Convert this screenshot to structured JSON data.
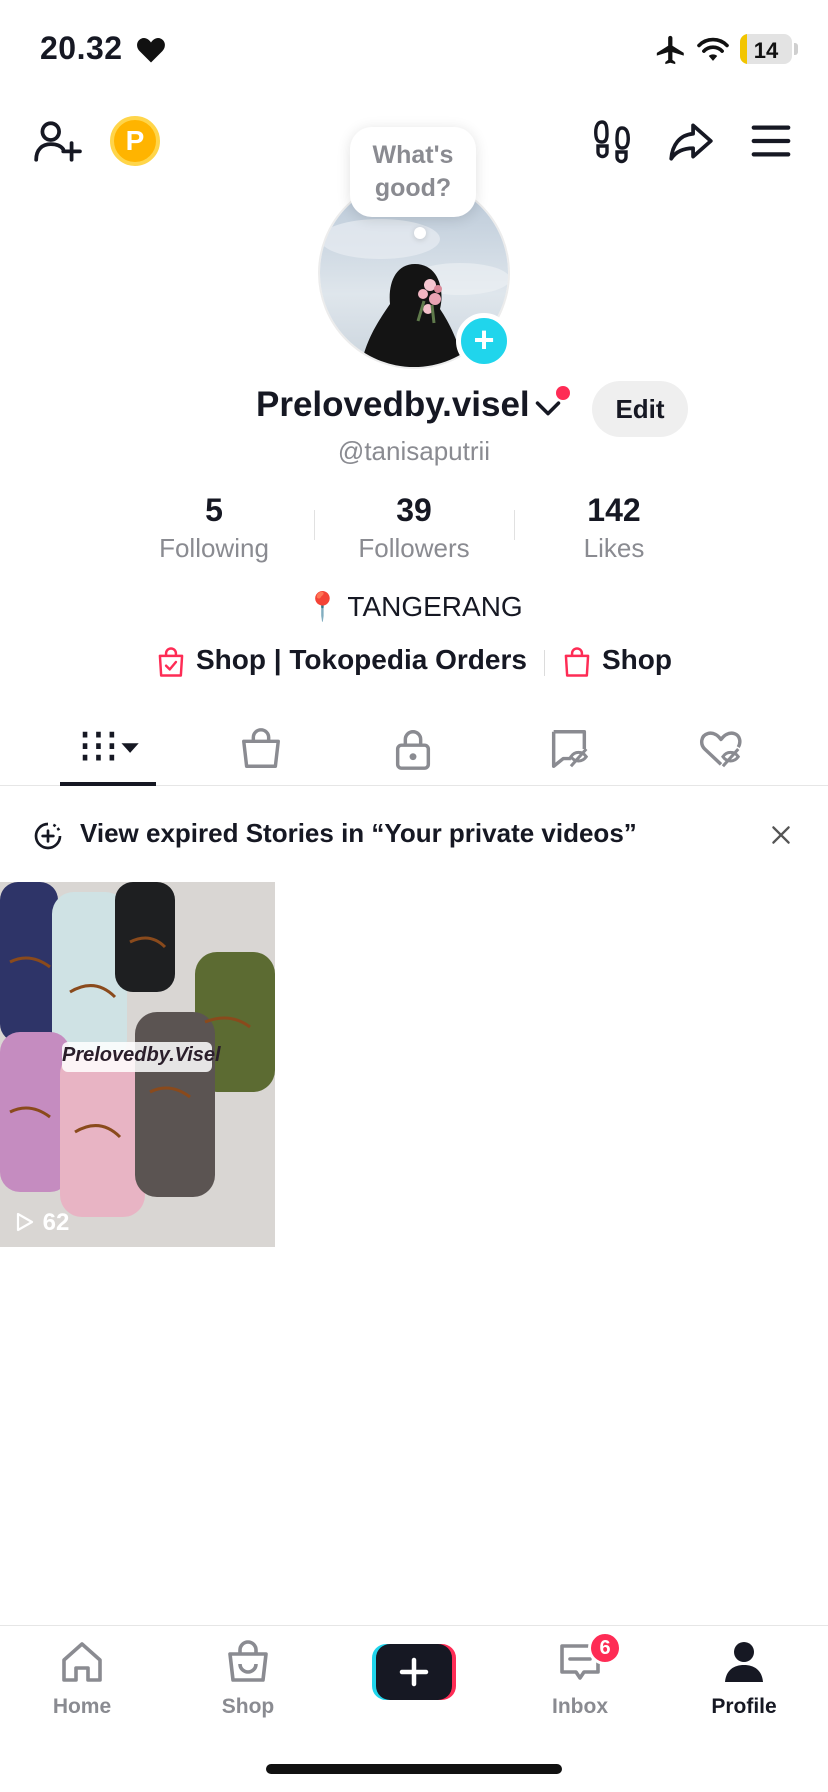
{
  "status_bar": {
    "time": "20.32",
    "battery_level": "14",
    "battery_fraction": 0.14,
    "icons": [
      "heart-icon",
      "airplane-icon",
      "wifi-icon",
      "battery-icon"
    ]
  },
  "header": {
    "icons": [
      "add-friend-icon",
      "coin-icon",
      "footprints-icon",
      "share-icon",
      "menu-icon"
    ],
    "coin_letter": "P"
  },
  "profile": {
    "note_bubble": "What's good?",
    "name": "Prelovedby.visel",
    "edit_label": "Edit",
    "handle": "@tanisaputrii",
    "location": "📍 TANGERANG"
  },
  "stats": [
    {
      "value": "5",
      "label": "Following"
    },
    {
      "value": "39",
      "label": "Followers"
    },
    {
      "value": "142",
      "label": "Likes"
    }
  ],
  "shop_links": [
    {
      "label": "Shop | Tokopedia Orders"
    },
    {
      "label": "Shop"
    }
  ],
  "tabs": [
    "videos-grid",
    "shop-bag",
    "private-lock",
    "reposts",
    "liked"
  ],
  "banner": {
    "text": "View expired Stories in “Your private videos”"
  },
  "videos": [
    {
      "views": "62",
      "overlay_text": "Prelovedby.Visel"
    }
  ],
  "bottom_nav": {
    "items": [
      {
        "label": "Home"
      },
      {
        "label": "Shop"
      },
      {
        "label": ""
      },
      {
        "label": "Inbox",
        "badge": "6"
      },
      {
        "label": "Profile"
      }
    ]
  },
  "colors": {
    "accent_red": "#fe2c55",
    "accent_cyan": "#20d5ec",
    "coin_gold": "#ffb400",
    "text_primary": "#161823",
    "text_secondary": "#8a8b91"
  }
}
